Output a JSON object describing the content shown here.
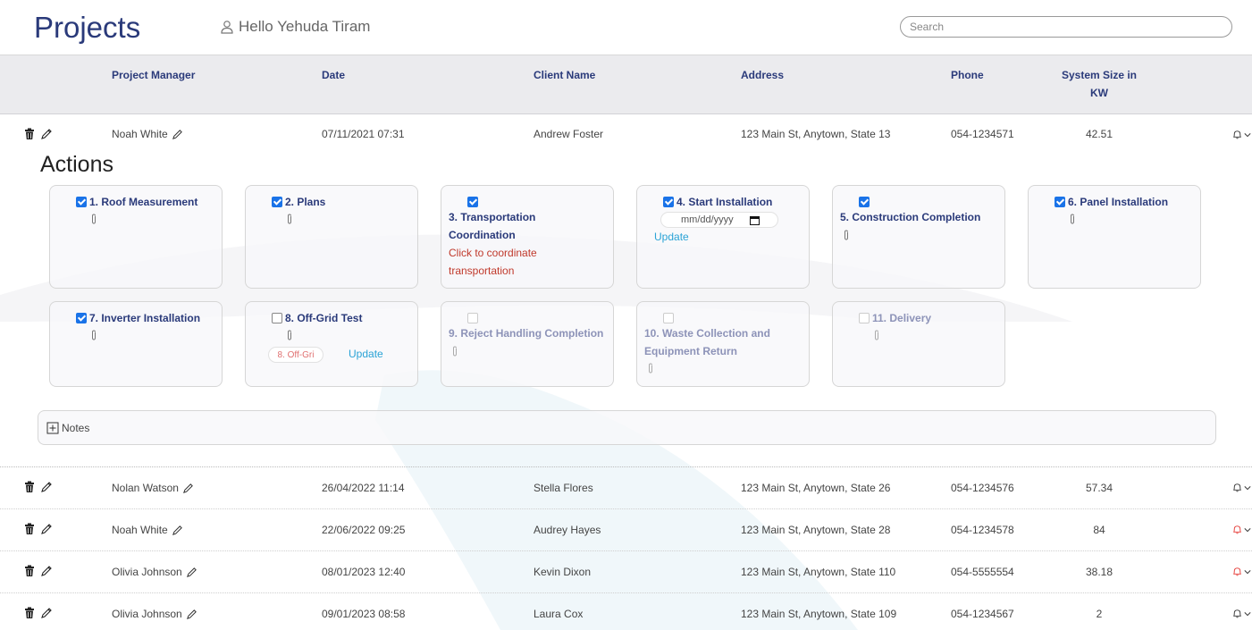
{
  "header": {
    "title": "Projects",
    "greeting": "Hello Yehuda Tiram",
    "search_placeholder": "Search"
  },
  "columns": {
    "project_manager": "Project Manager",
    "date": "Date",
    "client_name": "Client Name",
    "address": "Address",
    "phone": "Phone",
    "system_size_line1": "System Size in",
    "system_size_line2": "KW"
  },
  "rows": [
    {
      "manager": "Noah White",
      "date": "07/11/2021 07:31",
      "client": "Andrew Foster",
      "address": "123 Main St, Anytown, State 13",
      "phone": "054-1234571",
      "size": "42.51",
      "bell_alert": false
    },
    {
      "manager": "Nolan Watson",
      "date": "26/04/2022 11:14",
      "client": "Stella Flores",
      "address": "123 Main St, Anytown, State 26",
      "phone": "054-1234576",
      "size": "57.34",
      "bell_alert": false
    },
    {
      "manager": "Noah White",
      "date": "22/06/2022 09:25",
      "client": "Audrey Hayes",
      "address": "123 Main St, Anytown, State 28",
      "phone": "054-1234578",
      "size": "84",
      "bell_alert": true
    },
    {
      "manager": "Olivia Johnson",
      "date": "08/01/2023 12:40",
      "client": "Kevin Dixon",
      "address": "123 Main St, Anytown, State 110",
      "phone": "054-5555554",
      "size": "38.18",
      "bell_alert": true
    },
    {
      "manager": "Olivia Johnson",
      "date": "09/01/2023 08:58",
      "client": "Laura Cox",
      "address": "123 Main St, Anytown, State 109",
      "phone": "054-1234567",
      "size": "2",
      "bell_alert": false
    }
  ],
  "actions": {
    "title": "Actions",
    "a1": {
      "label": "1. Roof Measurement",
      "checked": true
    },
    "a2": {
      "label": "2. Plans",
      "checked": true
    },
    "a3": {
      "label_line1": "3. Transportation",
      "label_line2": "Coordination",
      "sub_line1": "Click to coordinate",
      "sub_line2": "transportation",
      "checked": true
    },
    "a4": {
      "label": "4. Start Installation",
      "date_placeholder": "mm/dd/yyyy",
      "update": "Update",
      "checked": true
    },
    "a5": {
      "label": "5. Construction Completion",
      "checked": true
    },
    "a6": {
      "label": "6. Panel Installation",
      "checked": true
    },
    "a7": {
      "label": "7. Inverter Installation",
      "checked": true
    },
    "a8": {
      "label": "8. Off-Grid Test",
      "input_value": "8. Off-Gri",
      "update": "Update",
      "checked": false
    },
    "a9": {
      "label": "9. Reject Handling Completion",
      "checked": false,
      "disabled": true
    },
    "a10": {
      "label_line1": "10. Waste Collection and",
      "label_line2": "Equipment Return",
      "checked": false,
      "disabled": true
    },
    "a11": {
      "label": "11. Delivery",
      "checked": false,
      "disabled": true
    }
  },
  "notes": {
    "label": "Notes"
  },
  "colors": {
    "title": "#2a3a7a",
    "checkbox": "#1a73e8",
    "link": "#2aa3d6",
    "warning": "#c0392b",
    "bell_alert": "#e53935"
  }
}
